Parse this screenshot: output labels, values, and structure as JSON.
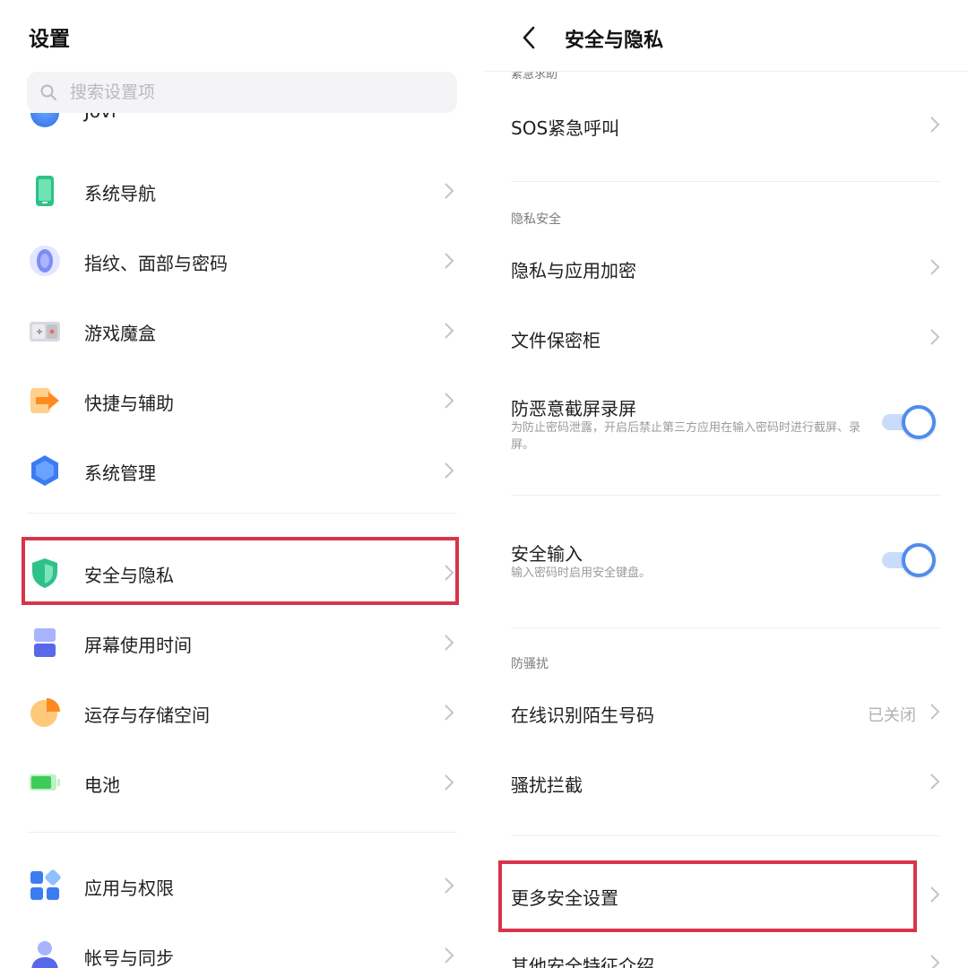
{
  "left": {
    "title": "设置",
    "search_placeholder": "搜索设置项",
    "partial_item": "Jovi",
    "items": [
      {
        "label": "系统导航",
        "icon": "phone-icon"
      },
      {
        "label": "指纹、面部与密码",
        "icon": "fingerprint-icon"
      },
      {
        "label": "游戏魔盒",
        "icon": "gamebox-icon"
      },
      {
        "label": "快捷与辅助",
        "icon": "shortcut-arrow-icon"
      },
      {
        "label": "系统管理",
        "icon": "hexagon-icon"
      },
      {
        "label": "安全与隐私",
        "icon": "shield-icon"
      },
      {
        "label": "屏幕使用时间",
        "icon": "hourglass-icon"
      },
      {
        "label": "运存与存储空间",
        "icon": "pie-chart-icon"
      },
      {
        "label": "电池",
        "icon": "battery-icon"
      },
      {
        "label": "应用与权限",
        "icon": "apps-grid-icon"
      },
      {
        "label": "帐号与同步",
        "icon": "person-icon"
      }
    ],
    "highlighted_item": "安全与隐私"
  },
  "right": {
    "title": "安全与隐私",
    "section_emergency": "紧急求助",
    "sos": "SOS紧急呼叫",
    "section_privacy": "隐私安全",
    "privacy_encrypt": "隐私与应用加密",
    "file_safe": "文件保密柜",
    "anti_screenshot": {
      "label": "防恶意截屏录屏",
      "desc": "为防止密码泄露，开启后禁止第三方应用在输入密码时进行截屏、录屏。",
      "enabled": true
    },
    "secure_input": {
      "label": "安全输入",
      "desc": "输入密码时启用安全键盘。",
      "enabled": true
    },
    "section_harass": "防骚扰",
    "online_id": {
      "label": "在线识别陌生号码",
      "value": "已关闭"
    },
    "harass_block": "骚扰拦截",
    "more_security": "更多安全设置",
    "other_features": "其他安全特征介绍",
    "highlighted_item": "更多安全设置"
  },
  "colors": {
    "highlight_border": "#d9344a",
    "toggle_accent": "#4f8cf0",
    "toggle_track": "#c9dcfb"
  }
}
